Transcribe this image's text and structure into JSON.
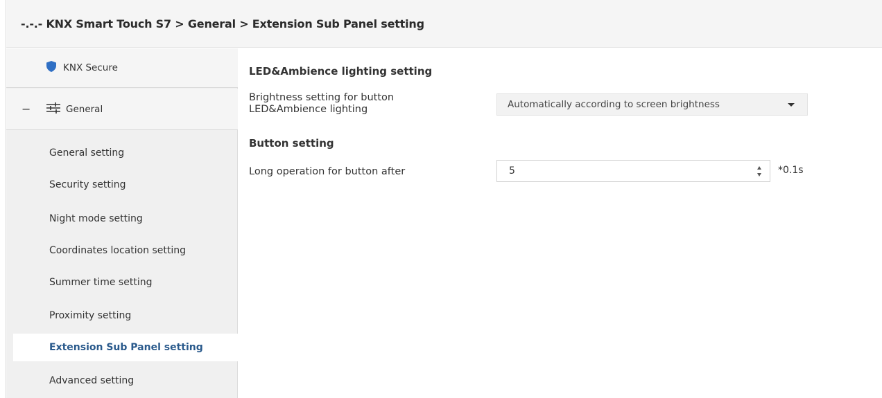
{
  "header": {
    "title": "-.-.- KNX Smart Touch S7 > General > Extension Sub Panel setting"
  },
  "sidebar": {
    "secure": {
      "label": "KNX Secure",
      "icon": "shield-icon"
    },
    "general": {
      "collapse": "−",
      "label": "General",
      "icon": "sliders-icon"
    },
    "items": [
      {
        "label": "General setting",
        "active": false
      },
      {
        "label": "Security setting",
        "active": false
      },
      {
        "label": "Night mode setting",
        "active": false
      },
      {
        "label": "Coordinates location setting",
        "active": false
      },
      {
        "label": "Summer time setting",
        "active": false
      },
      {
        "label": "Proximity setting",
        "active": false
      },
      {
        "label": "Extension Sub Panel setting",
        "active": true
      },
      {
        "label": "Advanced setting",
        "active": false
      }
    ]
  },
  "main": {
    "led_section_title": "LED&Ambience lighting setting",
    "brightness_label_line1": "Brightness setting for button",
    "brightness_label_line2": "LED&Ambience lighting",
    "brightness_value": "Automatically according to screen brightness",
    "button_section_title": "Button setting",
    "long_op_label": "Long operation for button after",
    "long_op_value": "5",
    "long_op_unit": "*0.1s"
  },
  "colors": {
    "accent_shield": "#2f6fc4",
    "active_item_text": "#2a5a8c",
    "sidebar_bg": "#f0f0f0"
  }
}
